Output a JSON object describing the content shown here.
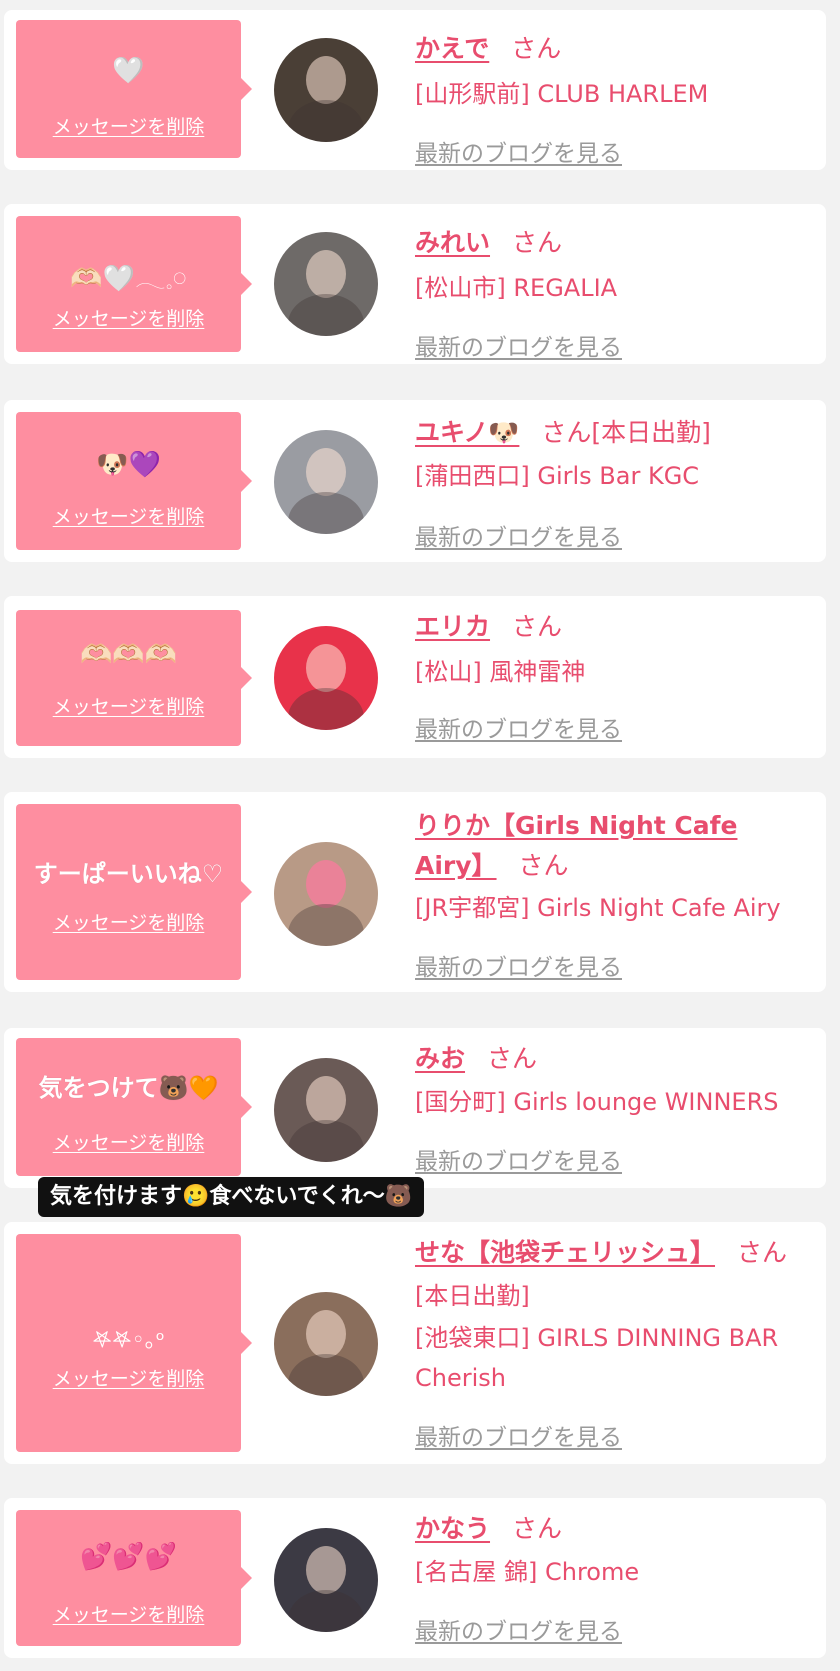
{
  "delete_label": "メッセージを削除",
  "blog_label": "最新のブログを見る",
  "san_label": "さん",
  "caption": "気を付けます🥲食べないでくれ〜🐻",
  "entries": [
    {
      "emoji": "🤍",
      "name": "かえで",
      "status": "",
      "shop": "[山形駅前] CLUB HARLEM",
      "avatar_color": "#4a3f36"
    },
    {
      "emoji": "🫶🏻🤍𓂃𓈒𓏸",
      "name": "みれい",
      "status": "",
      "shop": "[松山市] REGALIA",
      "avatar_color": "#6e6a68"
    },
    {
      "emoji": "🐶💜",
      "name": "ユキノ🐶",
      "status": "[本日出勤]",
      "shop": "[蒲田西口] Girls Bar KGC",
      "avatar_color": "#9a9ca2"
    },
    {
      "emoji": "🫶🏻🫶🏻🫶🏻",
      "name": "エリカ",
      "status": "",
      "shop": "[松山] 風神雷神",
      "avatar_color": "#e8324a"
    },
    {
      "emoji": "すーぱーいいね♡",
      "name": "りりか【Girls Night Cafe Airy】",
      "status": "",
      "shop": "[JR宇都宮] Girls Night Cafe Airy",
      "avatar_color": "#b89a86"
    },
    {
      "emoji": "気をつけて🐻🧡",
      "name": "みお",
      "status": "",
      "shop": "[国分町] Girls lounge WINNERS",
      "avatar_color": "#6a5a56"
    },
    {
      "emoji": "𖤐𖤐◦｡ᵒ",
      "name": "せな【池袋チェリッシュ】",
      "status": "[本日出勤]",
      "shop": "[池袋東口] GIRLS DINNING BAR Cherish",
      "avatar_color": "#8a6e5c"
    },
    {
      "emoji": "💕💕💕",
      "name": "かなう",
      "status": "",
      "shop": "[名古屋 錦] Chrome",
      "avatar_color": "#3c3a44"
    }
  ]
}
